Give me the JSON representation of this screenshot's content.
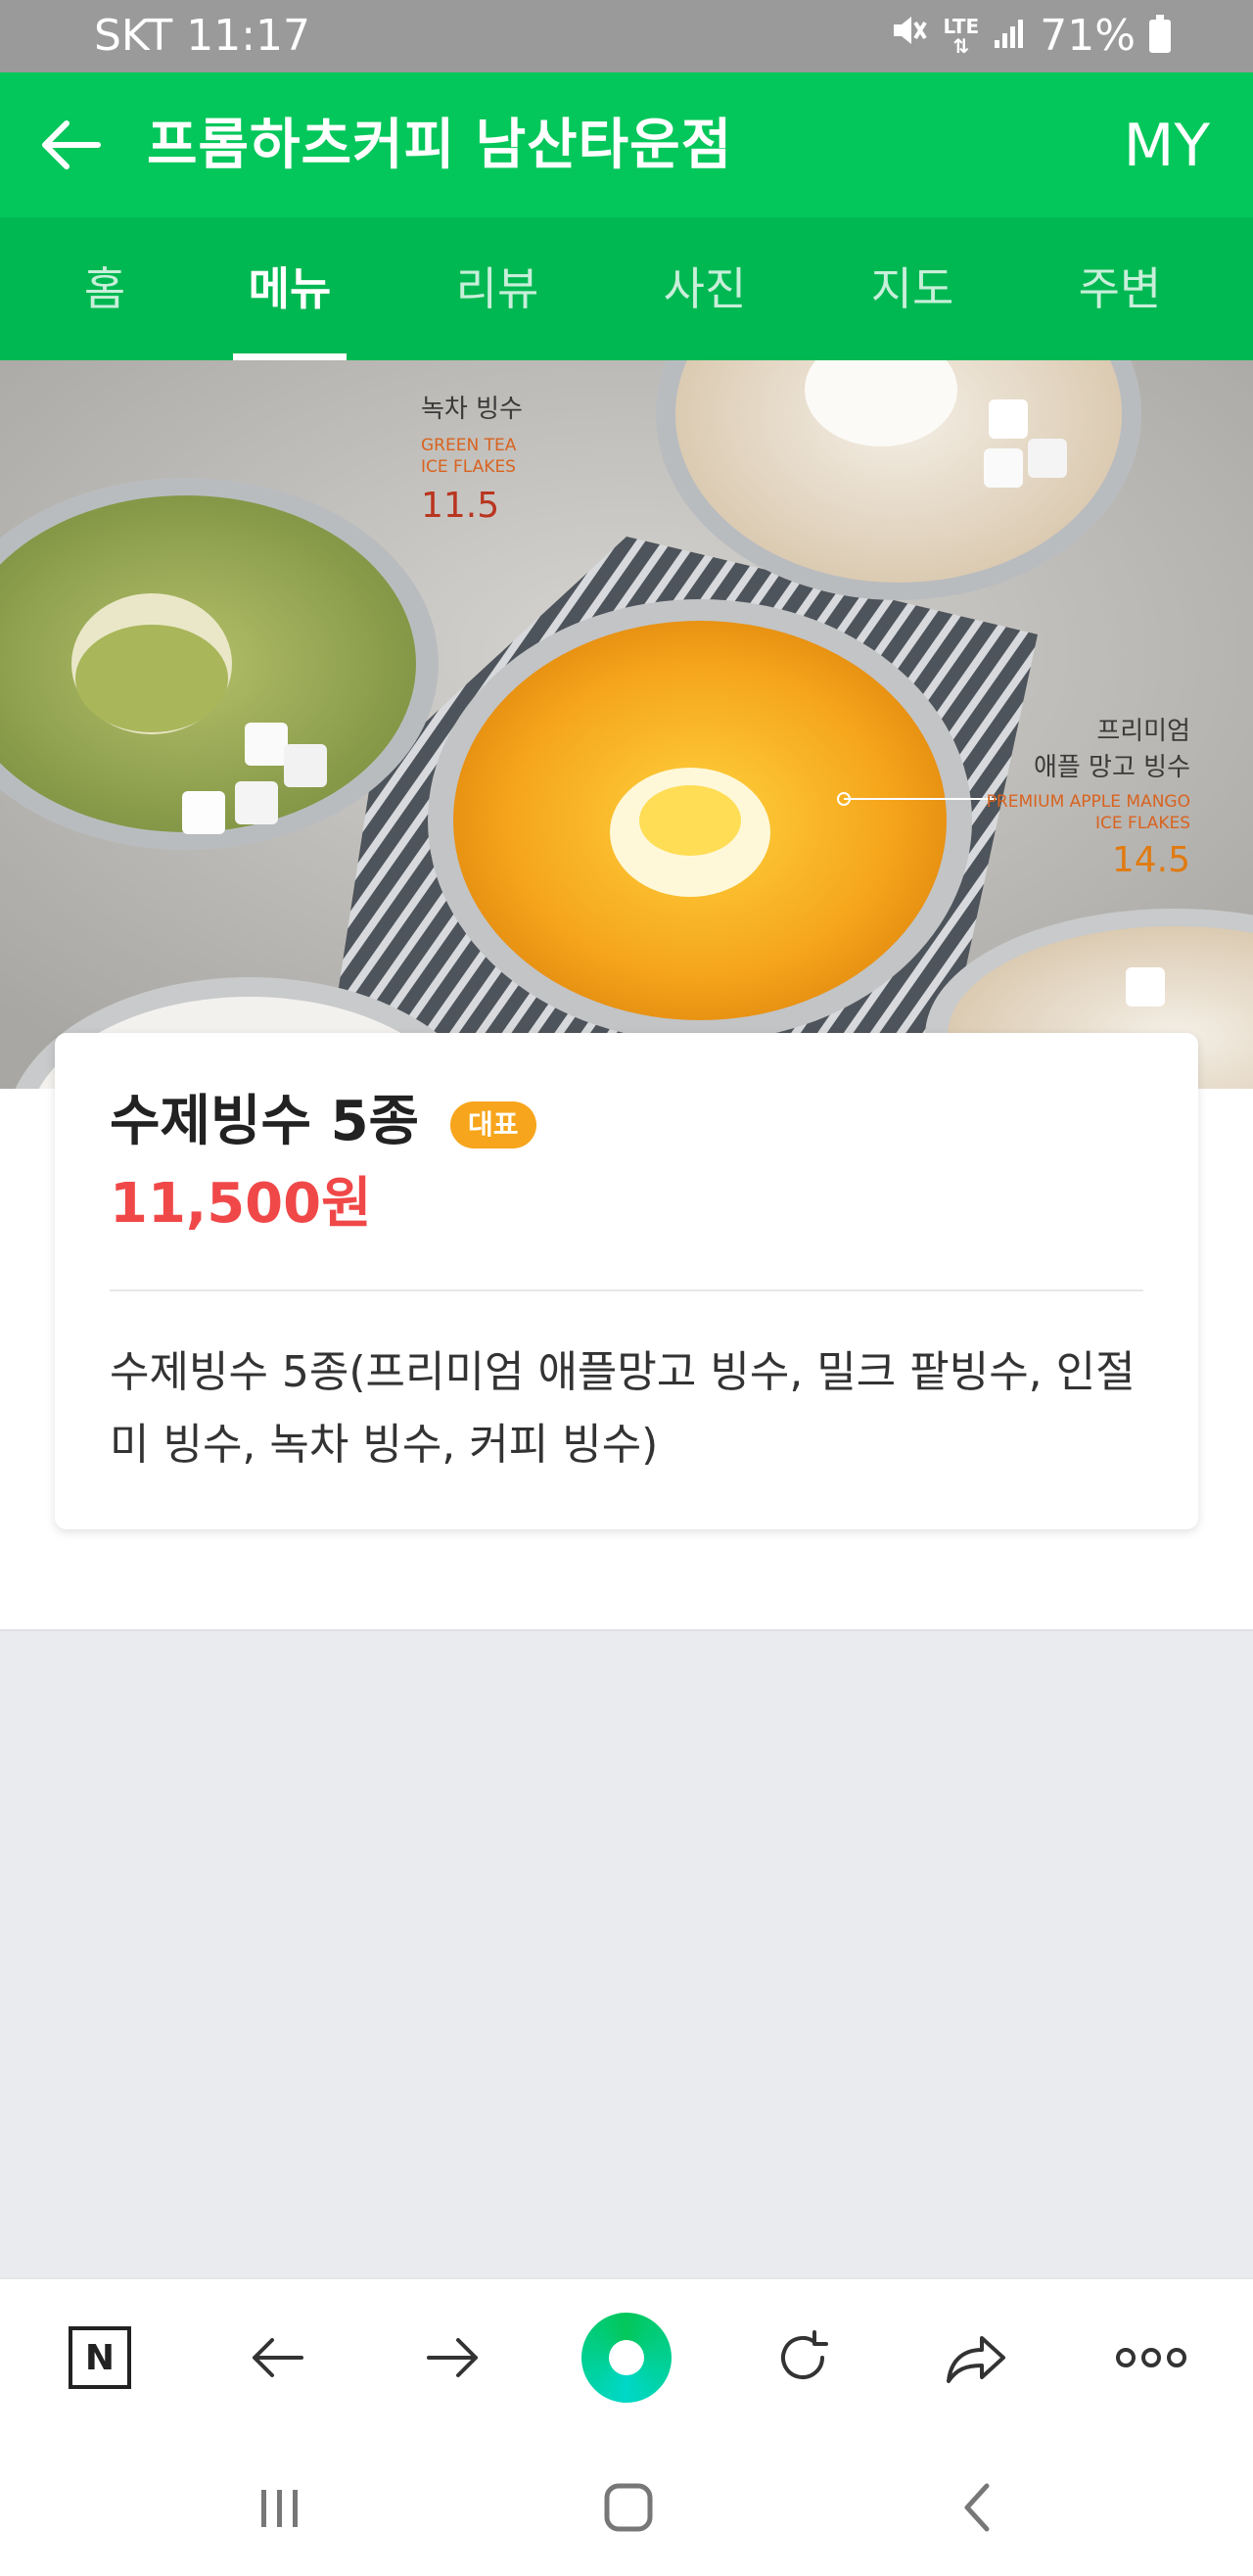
{
  "status_bar": {
    "carrier_time": "SKT 11:17",
    "lte_label": "LTE",
    "battery": "71%"
  },
  "header": {
    "title": "프롬하츠커피 남산타운점",
    "my_label": "MY"
  },
  "tabs": [
    {
      "label": "홈",
      "active": false
    },
    {
      "label": "메뉴",
      "active": true
    },
    {
      "label": "리뷰",
      "active": false
    },
    {
      "label": "사진",
      "active": false
    },
    {
      "label": "지도",
      "active": false
    },
    {
      "label": "주변",
      "active": false
    }
  ],
  "hero": {
    "left_title": "녹차 빙수",
    "left_en_1": "GREEN TEA",
    "left_en_2": "ICE FLAKES",
    "left_price": "11.5",
    "right_title_1": "프리미엄",
    "right_title_2": "애플 망고 빙수",
    "right_en_1": "PREMIUM APPLE MANGO",
    "right_en_2": "ICE FLAKES",
    "right_price": "14.5"
  },
  "menu_item": {
    "name": "수제빙수 5종",
    "badge": "대표",
    "price": "11,500원",
    "description": "수제빙수 5종(프리미엄 애플망고 빙수, 밀크 팥빙수, 인절미 빙수, 녹차 빙수, 커피 빙수)"
  },
  "browser_toolbar": {
    "home_letter": "N",
    "icons": [
      "naver-home-icon",
      "back-arrow-icon",
      "forward-arrow-icon",
      "green-dot-icon",
      "refresh-icon",
      "share-icon",
      "more-icon"
    ]
  },
  "colors": {
    "header_green": "#03c75a",
    "tab_green": "#00b852",
    "badge_orange": "#f7a51c",
    "price_red": "#f04848"
  }
}
